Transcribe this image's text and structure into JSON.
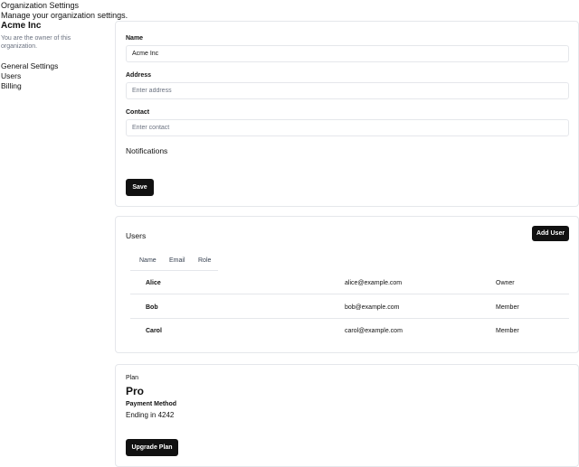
{
  "sidebar": {
    "title": "Organization Settings",
    "subtitle": "Manage your organization settings.",
    "org_name": "Acme Inc",
    "owner_note": "You are the owner of this organization.",
    "nav": [
      {
        "label": "General Settings"
      },
      {
        "label": "Users"
      },
      {
        "label": "Billing"
      }
    ]
  },
  "settings": {
    "name_label": "Name",
    "name_value": "Acme Inc",
    "address_label": "Address",
    "address_placeholder": "Enter address",
    "contact_label": "Contact",
    "contact_placeholder": "Enter contact",
    "notifications_label": "Notifications",
    "save_label": "Save"
  },
  "users": {
    "title": "Users",
    "add_label": "Add User",
    "columns": [
      "Name",
      "Email",
      "Role"
    ],
    "rows": [
      {
        "name": "Alice",
        "email": "alice@example.com",
        "role": "Owner"
      },
      {
        "name": "Bob",
        "email": "bob@example.com",
        "role": "Member"
      },
      {
        "name": "Carol",
        "email": "carol@example.com",
        "role": "Member"
      }
    ]
  },
  "plan": {
    "label": "Plan",
    "name": "Pro",
    "payment_label": "Payment Method",
    "payment_value": "Ending in 4242",
    "upgrade_label": "Upgrade Plan"
  },
  "colors": {
    "button_bg": "#111111",
    "border": "#e5e7eb",
    "muted_text": "#6b7280"
  }
}
